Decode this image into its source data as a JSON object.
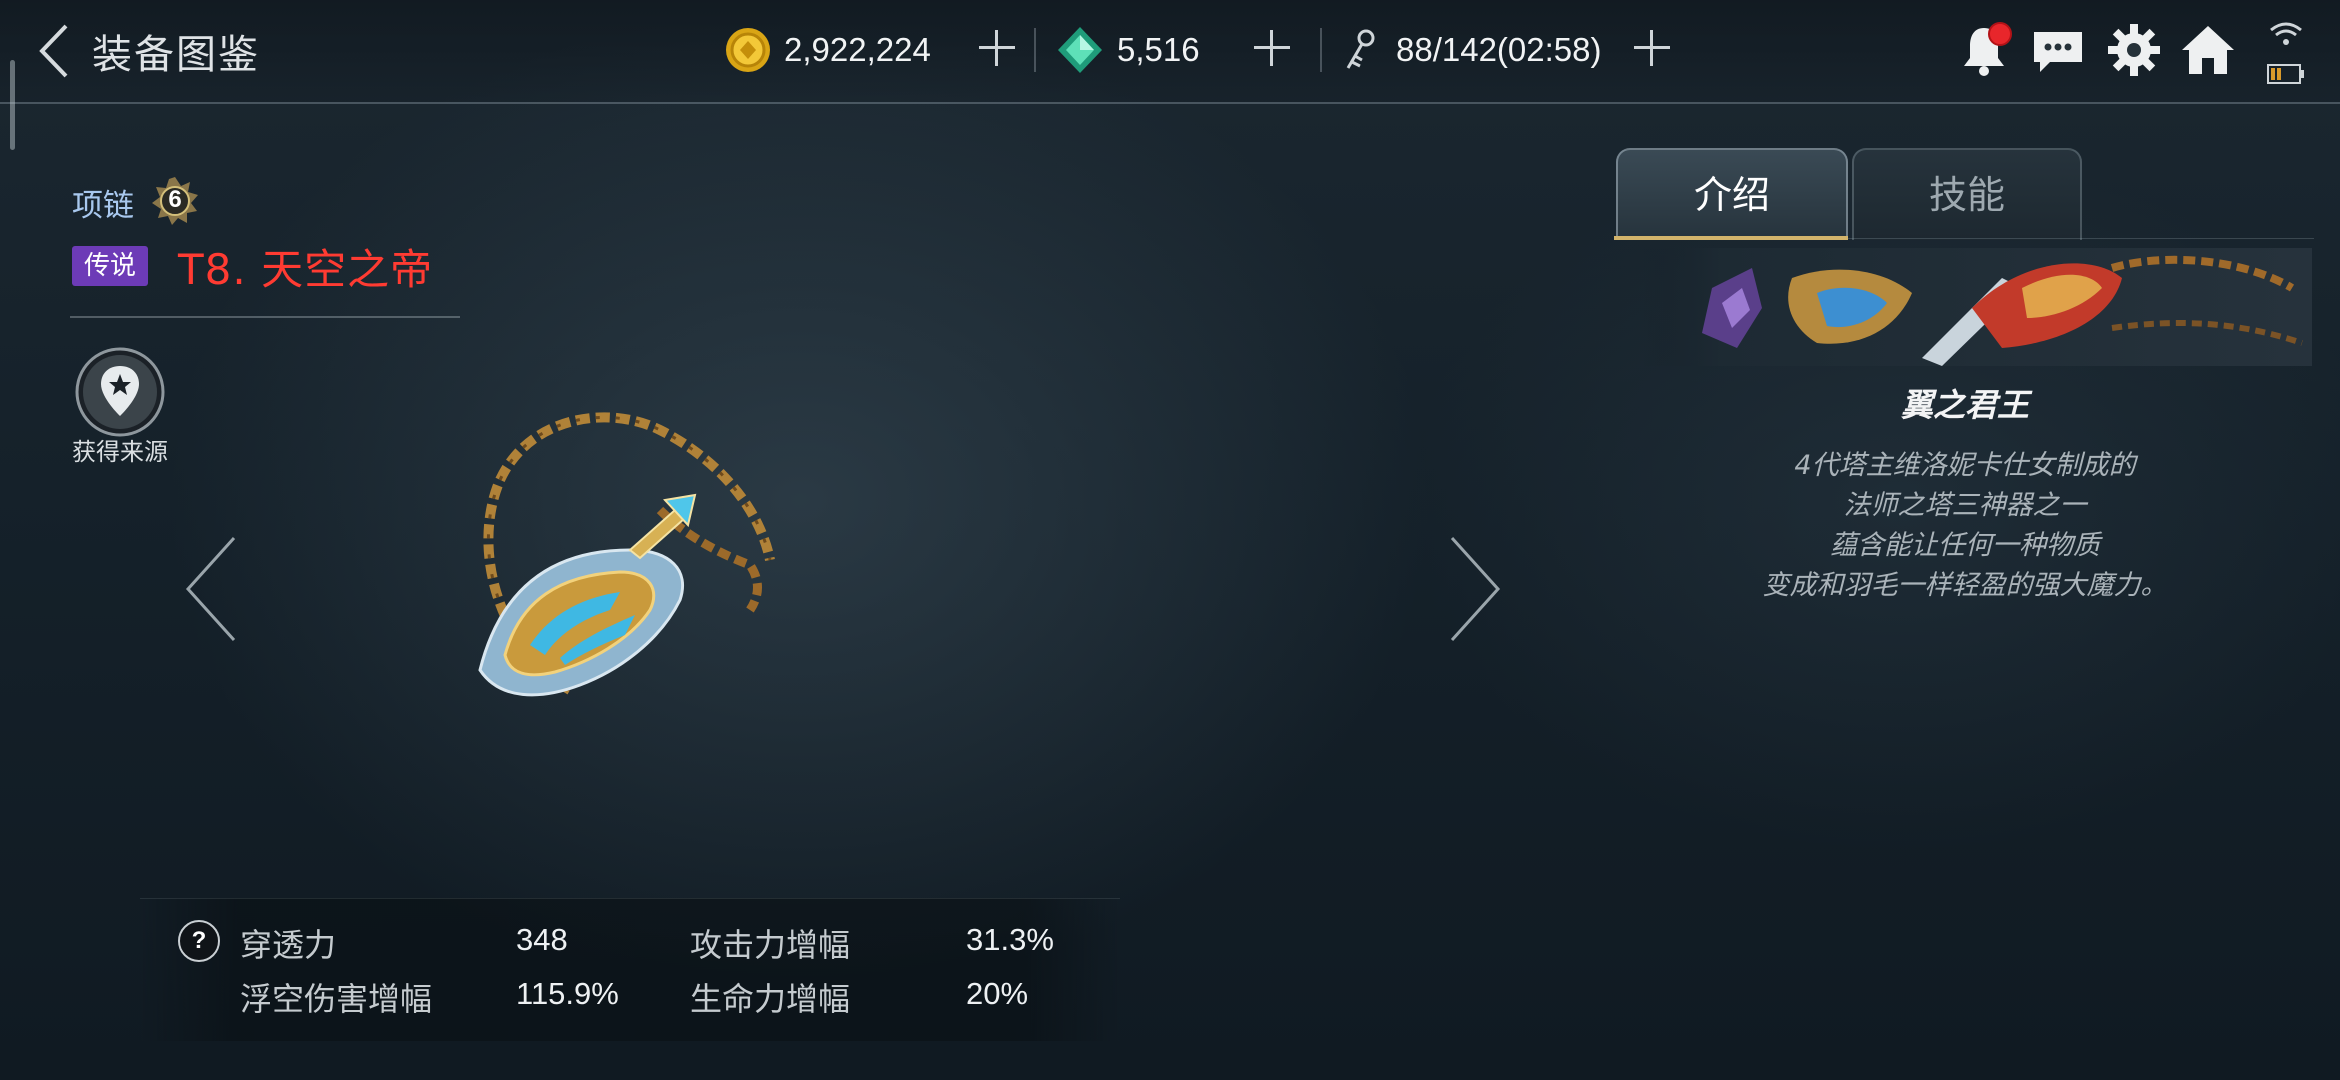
{
  "header": {
    "title": "装备图鉴",
    "gold": "2,922,224",
    "gems": "5,516",
    "stamina": "88/142(02:58)"
  },
  "item": {
    "type": "项链",
    "level": "6",
    "rarity": "传说",
    "name": "T8. 天空之帝",
    "source_label": "获得来源"
  },
  "stats": [
    {
      "label": "穿透力",
      "value": "348"
    },
    {
      "label": "攻击力增幅",
      "value": "31.3%"
    },
    {
      "label": "浮空伤害增幅",
      "value": "115.9%"
    },
    {
      "label": "生命力增幅",
      "value": "20%"
    }
  ],
  "tabs": [
    {
      "label": "介绍",
      "active": true
    },
    {
      "label": "技能",
      "active": false
    }
  ],
  "description": {
    "title": "翼之君王",
    "lines": [
      "4代塔主维洛妮卡仕女制成的",
      "法师之塔三神器之一",
      "蕴含能让任何一种物质",
      "变成和羽毛一样轻盈的强大魔力。"
    ]
  },
  "colors": {
    "rarity_bg": "#6d3bb7",
    "item_name": "#ff3b32",
    "item_type": "#a8c8ee",
    "tab_underline": "#d3b46b",
    "notification_dot": "#e8262b"
  },
  "icons": [
    "back-arrow-icon",
    "gold-coin-icon",
    "gem-icon",
    "stamina-key-icon",
    "bell-icon",
    "chat-icon",
    "gear-icon",
    "home-icon",
    "wifi-icon",
    "battery-icon",
    "level-badge-icon",
    "source-pin-icon",
    "prev-arrow-icon",
    "next-arrow-icon",
    "help-icon"
  ]
}
